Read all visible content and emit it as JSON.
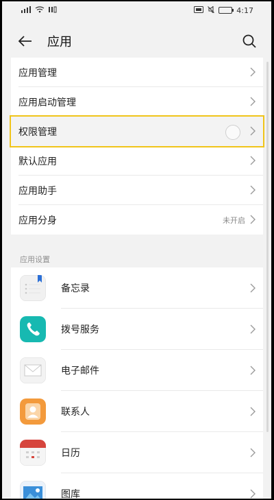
{
  "status_bar": {
    "time": "4:17",
    "left_icons": [
      "signal-icon",
      "wifi-icon",
      "network-speed-icon"
    ],
    "right_icons": [
      "hd-icon",
      "mute-icon",
      "battery-icon"
    ]
  },
  "header": {
    "title": "应用",
    "back_icon": "back-arrow-icon",
    "search_icon": "search-icon"
  },
  "menu": [
    {
      "label": "应用管理"
    },
    {
      "label": "应用启动管理"
    },
    {
      "label": "权限管理",
      "highlighted": true
    },
    {
      "label": "默认应用"
    },
    {
      "label": "应用助手"
    },
    {
      "label": "应用分身",
      "status": "未开启"
    }
  ],
  "app_settings": {
    "section_title": "应用设置",
    "apps": [
      {
        "label": "备忘录",
        "icon": "notes-icon"
      },
      {
        "label": "拨号服务",
        "icon": "phone-icon"
      },
      {
        "label": "电子邮件",
        "icon": "email-icon"
      },
      {
        "label": "联系人",
        "icon": "contacts-icon"
      },
      {
        "label": "日历",
        "icon": "calendar-icon"
      },
      {
        "label": "图库",
        "icon": "gallery-icon"
      }
    ]
  },
  "colors": {
    "highlight_border": "#f0c419",
    "phone_icon_bg": "#17b9b1",
    "contacts_icon_bg": "#f39a3c",
    "calendar_icon_accent": "#d6453d"
  }
}
